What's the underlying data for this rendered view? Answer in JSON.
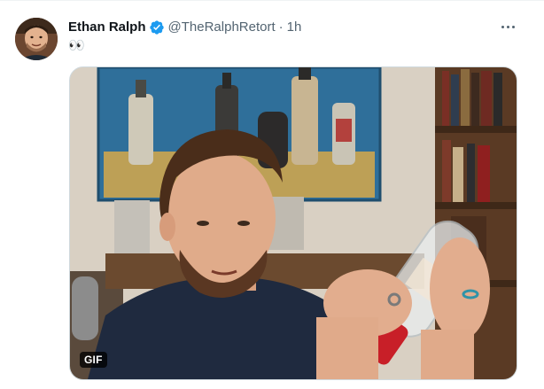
{
  "tweet": {
    "display_name": "Ethan Ralph",
    "handle": "@TheRalphRetort",
    "separator": "·",
    "time": "1h",
    "text": "👀",
    "verified": true,
    "media": {
      "type": "gif",
      "badge": "GIF"
    }
  },
  "icons": {
    "verified": "verified-badge-icon",
    "more": "more-options-icon"
  },
  "colors": {
    "accent": "#1d9bf0",
    "text_primary": "#0f1419",
    "text_secondary": "#536471",
    "border": "#cfd9de"
  }
}
